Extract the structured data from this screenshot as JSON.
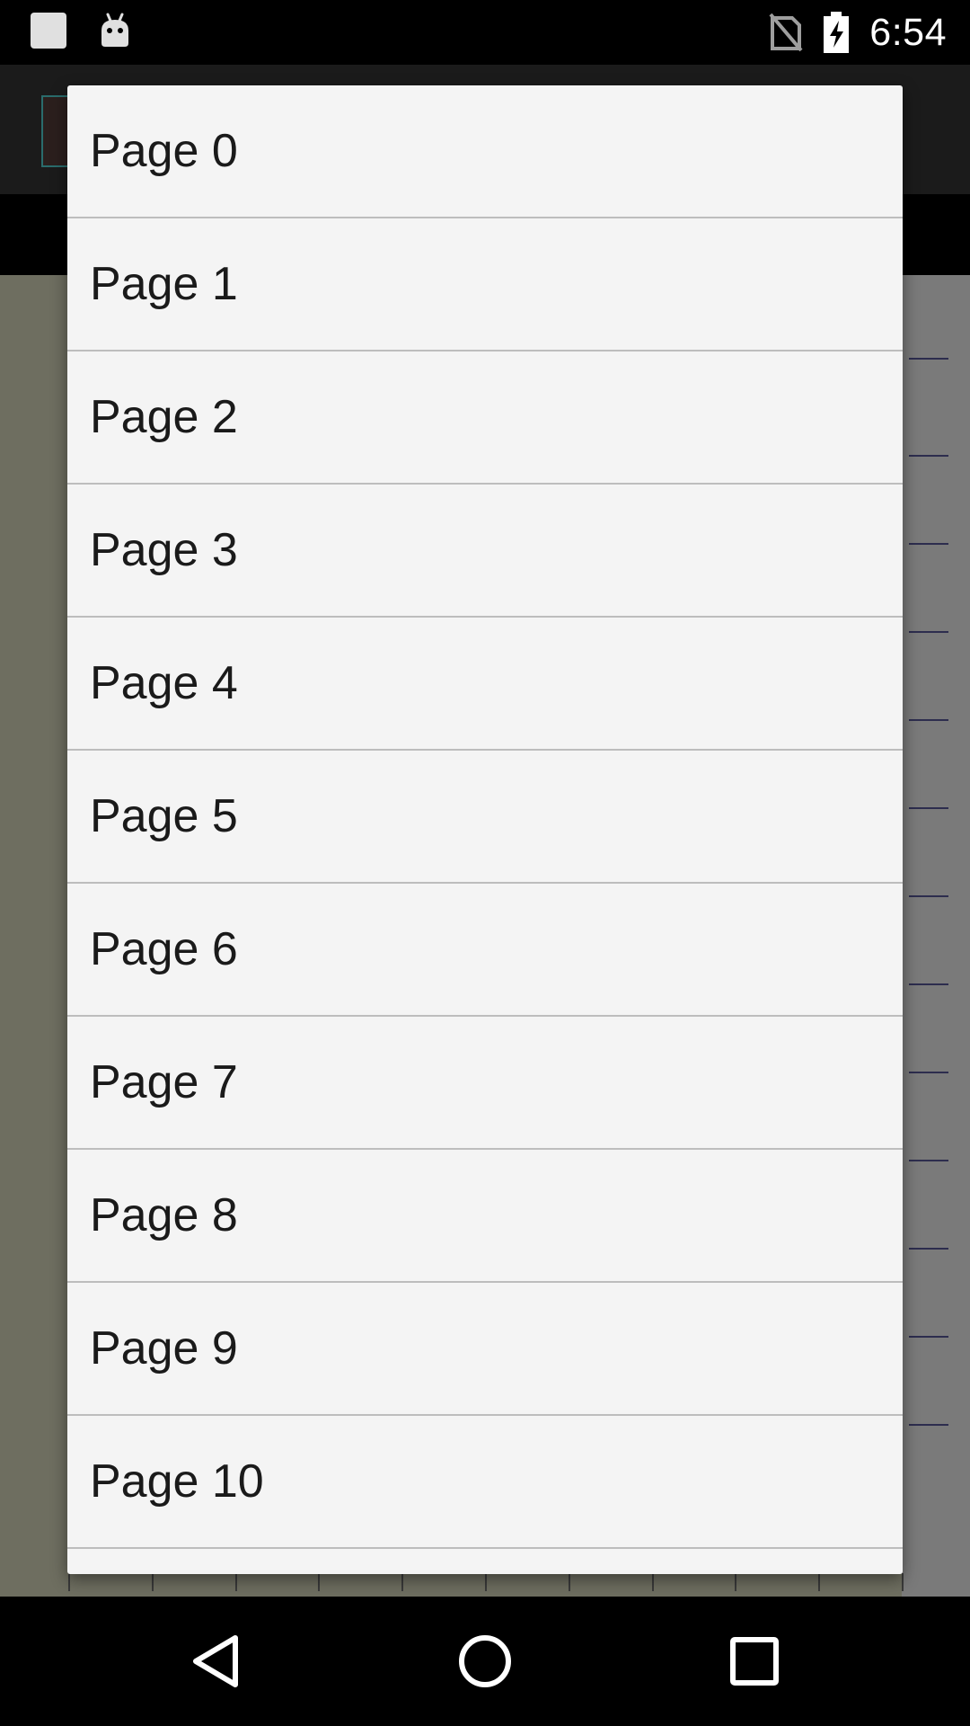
{
  "status_bar": {
    "time": "6:54",
    "icons": [
      "notification-square-icon",
      "android-notification-icon",
      "no-sim-icon",
      "battery-charging-icon"
    ]
  },
  "dialog": {
    "items": [
      {
        "label": "Page 0"
      },
      {
        "label": "Page 1"
      },
      {
        "label": "Page 2"
      },
      {
        "label": "Page 3"
      },
      {
        "label": "Page 4"
      },
      {
        "label": "Page 5"
      },
      {
        "label": "Page 6"
      },
      {
        "label": "Page 7"
      },
      {
        "label": "Page 8"
      },
      {
        "label": "Page 9"
      },
      {
        "label": "Page 10"
      },
      {
        "label": ""
      }
    ]
  },
  "nav_bar": {
    "icons": [
      "back-icon",
      "home-icon",
      "recents-icon"
    ]
  },
  "colors": {
    "dialog_background": "#f4f4f4",
    "divider": "#bdbdbd",
    "scrim_content": "#6e6e60",
    "status_bar": "#000000"
  }
}
